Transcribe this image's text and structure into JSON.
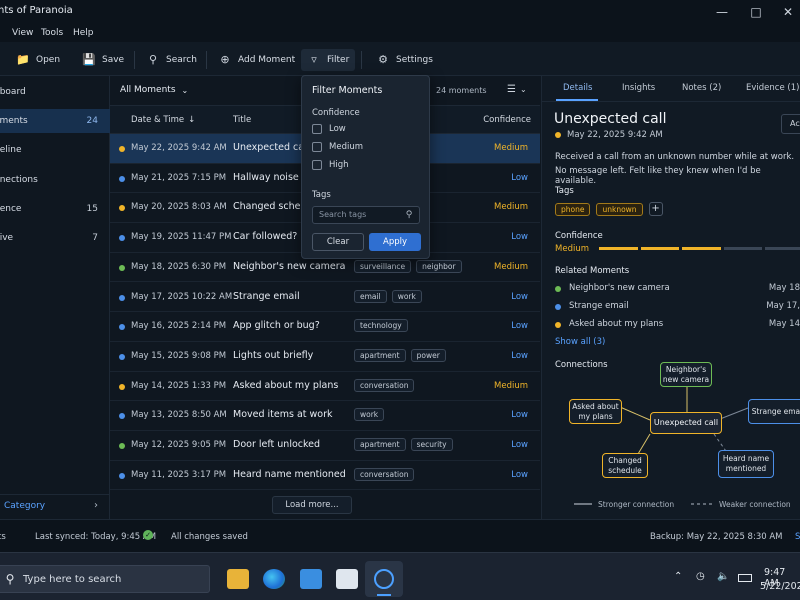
{
  "window": {
    "title": "nts of Paranoia"
  },
  "menu": [
    "View",
    "Tools",
    "Help"
  ],
  "toolbar": {
    "open": "Open",
    "save": "Save",
    "search": "Search",
    "add_moment": "Add Moment",
    "filter": "Filter",
    "settings": "Settings"
  },
  "sidebar": {
    "items": [
      {
        "label": "hboard",
        "count": ""
      },
      {
        "label": "oments",
        "count": "24"
      },
      {
        "label": "neline",
        "count": ""
      },
      {
        "label": "nnections",
        "count": ""
      },
      {
        "label": "dence",
        "count": "15"
      },
      {
        "label": "hive",
        "count": "7"
      }
    ],
    "footer": "Category"
  },
  "list": {
    "view": "All Moments",
    "count_text": "24 moments",
    "columns": {
      "date": "Date & Time",
      "title": "Title",
      "confidence": "Confidence"
    },
    "rows": [
      {
        "date": "May 22, 2025  9:42 AM",
        "title": "Unexpected call",
        "tags": [],
        "conf": "Medium",
        "dot": "#f0b429"
      },
      {
        "date": "May 21, 2025  7:15 PM",
        "title": "Hallway noise",
        "tags": [],
        "conf": "Low",
        "dot": "#4c8fe8"
      },
      {
        "date": "May 20, 2025  8:03 AM",
        "title": "Changed schedule",
        "tags": [],
        "conf": "Medium",
        "dot": "#f0b429"
      },
      {
        "date": "May 19, 2025  11:47 PM",
        "title": "Car followed?",
        "tags": [],
        "conf": "Low",
        "dot": "#4c8fe8"
      },
      {
        "date": "May 18, 2025  6:30 PM",
        "title": "Neighbor's new camera",
        "tags": [
          "surveillance",
          "neighbor"
        ],
        "conf": "Medium",
        "dot": "#6dbb55"
      },
      {
        "date": "May 17, 2025  10:22 AM",
        "title": "Strange email",
        "tags": [
          "email",
          "work"
        ],
        "conf": "Low",
        "dot": "#4c8fe8"
      },
      {
        "date": "May 16, 2025  2:14 PM",
        "title": "App glitch or bug?",
        "tags": [
          "technology"
        ],
        "conf": "Low",
        "dot": "#4c8fe8"
      },
      {
        "date": "May 15, 2025  9:08 PM",
        "title": "Lights out briefly",
        "tags": [
          "apartment",
          "power"
        ],
        "conf": "Low",
        "dot": "#4c8fe8"
      },
      {
        "date": "May 14, 2025  1:33 PM",
        "title": "Asked about my plans",
        "tags": [
          "conversation"
        ],
        "conf": "Medium",
        "dot": "#f0b429"
      },
      {
        "date": "May 13, 2025  8:50 AM",
        "title": "Moved items at work",
        "tags": [
          "work"
        ],
        "conf": "Low",
        "dot": "#4c8fe8"
      },
      {
        "date": "May 12, 2025  9:05 PM",
        "title": "Door left unlocked",
        "tags": [
          "apartment",
          "security"
        ],
        "conf": "Low",
        "dot": "#6dbb55"
      },
      {
        "date": "May 11, 2025  3:17 PM",
        "title": "Heard name mentioned",
        "tags": [
          "conversation"
        ],
        "conf": "Low",
        "dot": "#4c8fe8"
      }
    ],
    "load_more": "Load more..."
  },
  "filter": {
    "title": "Filter Moments",
    "confidence_label": "Confidence",
    "options": [
      "Low",
      "Medium",
      "High"
    ],
    "tags_label": "Tags",
    "tags_placeholder": "Search tags",
    "clear": "Clear",
    "apply": "Apply"
  },
  "detail": {
    "tabs": [
      "Details",
      "Insights",
      "Notes (2)",
      "Evidence (1)"
    ],
    "action": "Act",
    "title": "Unexpected call",
    "date": "May 22, 2025  9:42 AM",
    "description_1": "Received a call from an unknown number while at work.",
    "description_2": "No message left. Felt like they knew when I'd be available.",
    "tags_label": "Tags",
    "tags": [
      "phone",
      "unknown"
    ],
    "add_tag": "+",
    "confidence_label": "Confidence",
    "confidence_value": "Medium",
    "confidence_level": 0.6,
    "related_label": "Related Moments",
    "related": [
      {
        "title": "Neighbor's new camera",
        "when": "May 18",
        "dot": "#6dbb55"
      },
      {
        "title": "Strange email",
        "when": "May 17,",
        "dot": "#4c8fe8"
      },
      {
        "title": "Asked about my plans",
        "when": "May 14",
        "dot": "#f0b429"
      }
    ],
    "show_all": "Show all (3)",
    "connections_label": "Connections",
    "graph": {
      "center": "Unexpected call",
      "n1": "Neighbor's new camera",
      "n2": "Asked about my plans",
      "n3": "Strange email",
      "n4": "Changed schedule",
      "n5": "Heard name mentioned"
    },
    "legend_strong": "Stronger connection",
    "legend_weak": "Weaker connection"
  },
  "status": {
    "left": "ts",
    "synced": "Last synced: Today, 9:45 AM",
    "saved": "All changes saved",
    "backup": "Backup: May 22, 2025 8:30 AM",
    "right": "S"
  },
  "taskbar": {
    "search_placeholder": "Type here to search",
    "time": "9:47 AM",
    "date": "5/22/202"
  },
  "colors": {
    "accent": "#5aa2ff",
    "medium": "#f0b429",
    "low": "#4c8fe8",
    "green": "#6dbb55"
  }
}
